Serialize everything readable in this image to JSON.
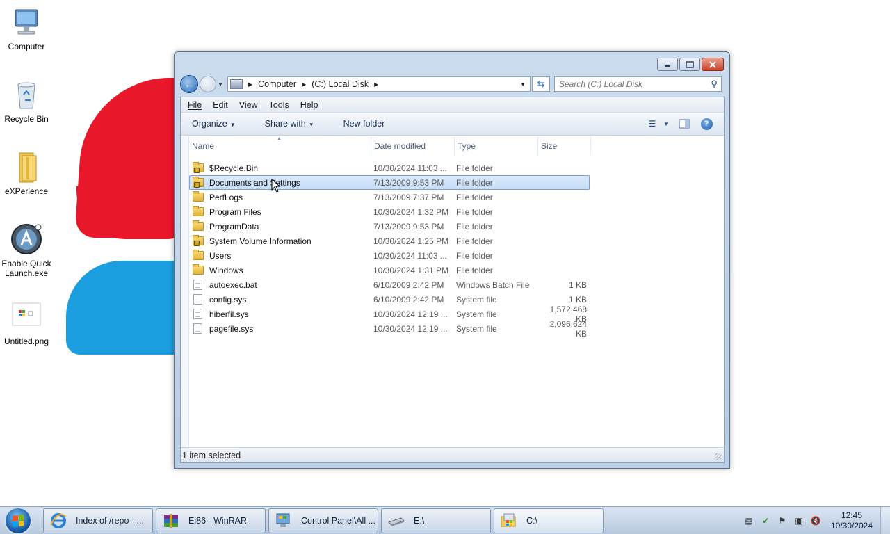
{
  "desktop": {
    "icons": [
      {
        "label": "Computer",
        "icon": "computer-icon"
      },
      {
        "label": "Recycle Bin",
        "icon": "recycle-bin-icon"
      },
      {
        "label": "eXPerience",
        "icon": "folder-icon"
      },
      {
        "label": "Enable Quick Launch.exe",
        "icon": "app-icon"
      },
      {
        "label": "Untitled.png",
        "icon": "image-file-icon"
      }
    ]
  },
  "window": {
    "address": {
      "crumbs": [
        "Computer",
        "(C:) Local Disk"
      ]
    },
    "search": {
      "placeholder": "Search (C:) Local Disk"
    },
    "menu": [
      "File",
      "Edit",
      "View",
      "Tools",
      "Help"
    ],
    "commands": {
      "organize": "Organize",
      "share_with": "Share with",
      "new_folder": "New folder"
    },
    "columns": {
      "name": "Name",
      "date": "Date modified",
      "type": "Type",
      "size": "Size"
    },
    "rows": [
      {
        "name": "$Recycle.Bin",
        "date": "10/30/2024 11:03 ...",
        "type": "File folder",
        "size": "",
        "kind": "folder-locked"
      },
      {
        "name": "Documents and Settings",
        "date": "7/13/2009 9:53 PM",
        "type": "File folder",
        "size": "",
        "kind": "folder-locked",
        "selected": true
      },
      {
        "name": "PerfLogs",
        "date": "7/13/2009 7:37 PM",
        "type": "File folder",
        "size": "",
        "kind": "folder"
      },
      {
        "name": "Program Files",
        "date": "10/30/2024 1:32 PM",
        "type": "File folder",
        "size": "",
        "kind": "folder"
      },
      {
        "name": "ProgramData",
        "date": "7/13/2009 9:53 PM",
        "type": "File folder",
        "size": "",
        "kind": "folder"
      },
      {
        "name": "System Volume Information",
        "date": "10/30/2024 1:25 PM",
        "type": "File folder",
        "size": "",
        "kind": "folder-locked"
      },
      {
        "name": "Users",
        "date": "10/30/2024 11:03 ...",
        "type": "File folder",
        "size": "",
        "kind": "folder"
      },
      {
        "name": "Windows",
        "date": "10/30/2024 1:31 PM",
        "type": "File folder",
        "size": "",
        "kind": "folder"
      },
      {
        "name": "autoexec.bat",
        "date": "6/10/2009 2:42 PM",
        "type": "Windows Batch File",
        "size": "1 KB",
        "kind": "file"
      },
      {
        "name": "config.sys",
        "date": "6/10/2009 2:42 PM",
        "type": "System file",
        "size": "1 KB",
        "kind": "file"
      },
      {
        "name": "hiberfil.sys",
        "date": "10/30/2024 12:19 ...",
        "type": "System file",
        "size": "1,572,468 KB",
        "kind": "file"
      },
      {
        "name": "pagefile.sys",
        "date": "10/30/2024 12:19 ...",
        "type": "System file",
        "size": "2,096,624 KB",
        "kind": "file"
      }
    ],
    "status": "1 item selected"
  },
  "taskbar": {
    "tasks": [
      {
        "label": "Index of /repo - ...",
        "icon": "internet-explorer-icon"
      },
      {
        "label": "Ei86 - WinRAR",
        "icon": "winrar-icon"
      },
      {
        "label": "Control Panel\\All ...",
        "icon": "control-panel-icon"
      },
      {
        "label": "E:\\",
        "icon": "drive-icon"
      },
      {
        "label": "C:\\",
        "icon": "explorer-icon",
        "active": true
      }
    ],
    "clock": {
      "time": "12:45",
      "date": "10/30/2024"
    }
  },
  "colors": {
    "selection": "#c6ddf7",
    "accent": "#2a6bb6",
    "deco_red": "#e8172a",
    "deco_blue": "#1a9ee0"
  }
}
